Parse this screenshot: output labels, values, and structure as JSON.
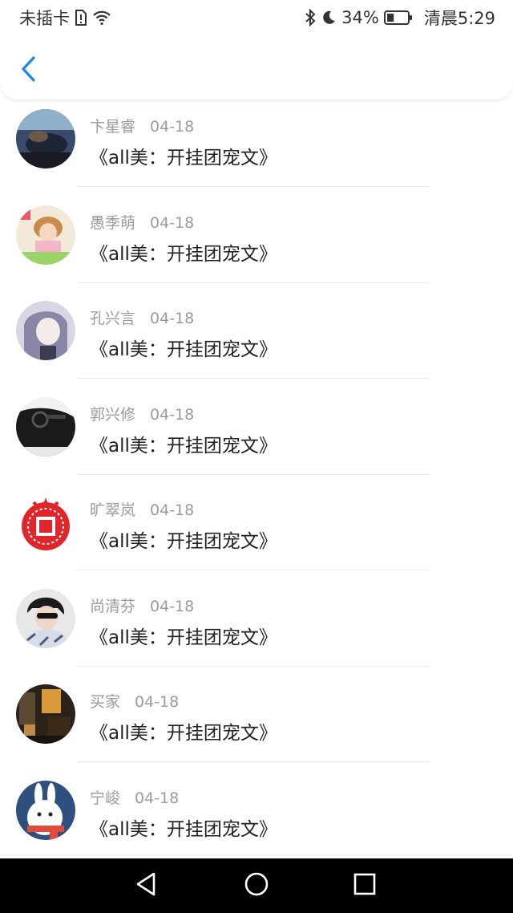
{
  "status_bar": {
    "carrier": "未插卡",
    "battery_percent": "34%",
    "time": "清晨5:29",
    "battery_level": 0.34,
    "icons": [
      "sim-alert-icon",
      "wifi-icon",
      "bluetooth-icon",
      "moon-icon",
      "battery-icon"
    ]
  },
  "header": {
    "back_icon": "chevron-left-icon",
    "accent": "#1e88e5"
  },
  "feed": [
    {
      "name": "卞星睿",
      "date": "04-18",
      "title": "《all美：开挂团宠文》"
    },
    {
      "name": "愚季萌",
      "date": "04-18",
      "title": "《all美：开挂团宠文》"
    },
    {
      "name": "孔兴言",
      "date": "04-18",
      "title": "《all美：开挂团宠文》"
    },
    {
      "name": "郭兴修",
      "date": "04-18",
      "title": "《all美：开挂团宠文》"
    },
    {
      "name": "旷翠岚",
      "date": "04-18",
      "title": "《all美：开挂团宠文》"
    },
    {
      "name": "尚清芬",
      "date": "04-18",
      "title": "《all美：开挂团宠文》"
    },
    {
      "name": "买家",
      "date": "04-18",
      "title": "《all美：开挂团宠文》"
    },
    {
      "name": "宁峻",
      "date": "04-18",
      "title": "《all美：开挂团宠文》"
    }
  ],
  "nav_bar": {
    "icons": [
      "back-triangle-icon",
      "home-circle-icon",
      "recents-square-icon"
    ]
  }
}
